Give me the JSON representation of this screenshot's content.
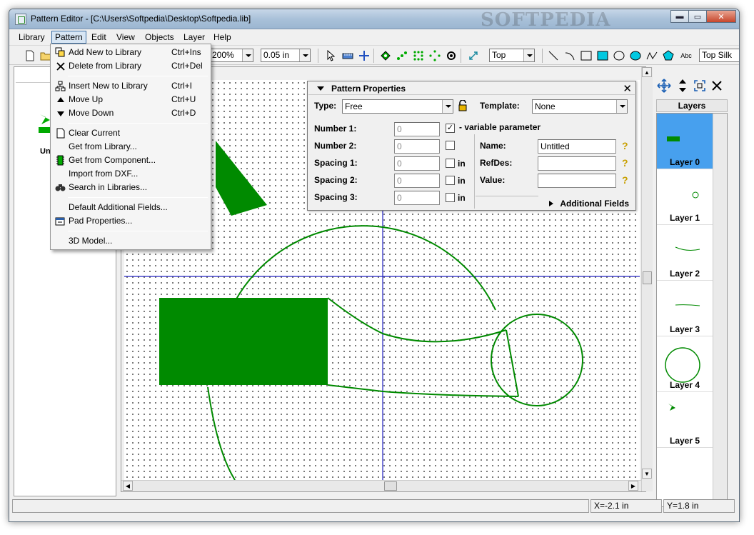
{
  "window": {
    "title": "Pattern Editor - [C:\\Users\\Softpedia\\Desktop\\Softpedia.lib]",
    "watermark": "SOFTPEDIA",
    "min_label": "▬",
    "max_label": "▭",
    "close_label": "✕"
  },
  "menubar": {
    "items": [
      "Library",
      "Pattern",
      "Edit",
      "View",
      "Objects",
      "Layer",
      "Help"
    ],
    "active": "Pattern"
  },
  "toolbar": {
    "zoom": "200%",
    "grid": "0.05 in",
    "side": "Top",
    "layer": "Top Silk",
    "text_tool_label": "Abc"
  },
  "left_panel": {
    "item_label": "Un"
  },
  "pattern_menu": {
    "items": [
      {
        "label": "Add New to Library",
        "shortcut": "Ctrl+Ins",
        "icon": "add-library-icon"
      },
      {
        "label": "Delete from Library",
        "shortcut": "Ctrl+Del",
        "icon": "delete-x-icon"
      },
      {
        "label": "Insert New to Library",
        "shortcut": "Ctrl+I",
        "icon": "insert-tree-icon"
      },
      {
        "label": "Move Up",
        "shortcut": "Ctrl+U",
        "icon": "arrow-up-icon"
      },
      {
        "label": "Move Down",
        "shortcut": "Ctrl+D",
        "icon": "arrow-down-icon"
      },
      {
        "label": "Clear Current",
        "shortcut": "",
        "icon": "blank-page-icon"
      },
      {
        "label": "Get from Library...",
        "shortcut": "",
        "icon": ""
      },
      {
        "label": "Get from Component...",
        "shortcut": "",
        "icon": "chip-icon"
      },
      {
        "label": "Import from DXF...",
        "shortcut": "",
        "icon": ""
      },
      {
        "label": "Search in Libraries...",
        "shortcut": "",
        "icon": "binoculars-icon"
      },
      {
        "label": "Default Additional Fields...",
        "shortcut": "",
        "icon": ""
      },
      {
        "label": "Pad Properties...",
        "shortcut": "",
        "icon": "pad-properties-icon"
      },
      {
        "label": "3D Model...",
        "shortcut": "",
        "icon": ""
      }
    ]
  },
  "pattern_properties": {
    "title": "Pattern Properties",
    "close": "✕",
    "type_label": "Type:",
    "type_value": "Free",
    "template_label": "Template:",
    "template_value": "None",
    "number1_label": "Number 1:",
    "number1_value": "0",
    "number2_label": "Number 2:",
    "number2_value": "0",
    "spacing1_label": "Spacing 1:",
    "spacing1_value": "0",
    "spacing2_label": "Spacing 2:",
    "spacing2_value": "0",
    "spacing3_label": "Spacing 3:",
    "spacing3_value": "0",
    "variable_param_label": "- variable parameter",
    "variable_param_checked": true,
    "in_label": "in",
    "name_label": "Name:",
    "name_value": "Untitled",
    "refdes_label": "RefDes:",
    "refdes_value": "",
    "value_label": "Value:",
    "value_value": "",
    "additional_fields_label": "Additional Fields",
    "help_glyph": "?"
  },
  "layers": {
    "header": "Layers",
    "items": [
      "Layer 0",
      "Layer 1",
      "Layer 2",
      "Layer 3",
      "Layer 4",
      "Layer 5"
    ],
    "selected": "Layer 0"
  },
  "status": {
    "x": "X=-2.1 in",
    "y": "Y=1.8 in"
  },
  "colors": {
    "pattern_green": "#008a00",
    "axis_blue": "#2020c0",
    "selected_layer": "#47a0ee",
    "menu_highlight": "#d8e6f4"
  }
}
